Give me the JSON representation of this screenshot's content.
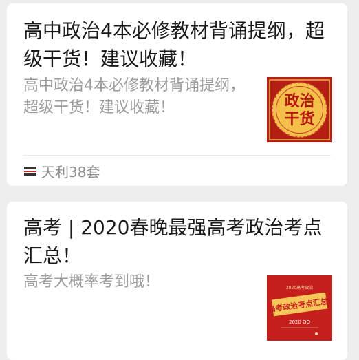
{
  "articles": [
    {
      "title": "高中政治4本必修教材背诵提纲，超级干货！建议收藏！",
      "summary": "高中政治4本必修教材背诵提纲，超级干货！建议收藏！",
      "thumbnail": {
        "text": [
          "政治",
          "干货"
        ]
      },
      "source": {
        "name": "天利38套"
      }
    },
    {
      "title": "高考 | 2020春晚最强高考政治考点汇总！",
      "summary": "高考大概率考到哦！",
      "thumbnail": {
        "main": "高考政治考点汇总!",
        "top": "2020高考政治",
        "bottom": "2020 GO"
      }
    }
  ],
  "colors": {
    "page_bg": "#ededed",
    "card_bg": "#ffffff",
    "title": "#1a1a1a",
    "summary": "#9c9c9c",
    "thumb_red": "#c41f1a",
    "thumb_gold": "#f2c24a"
  }
}
